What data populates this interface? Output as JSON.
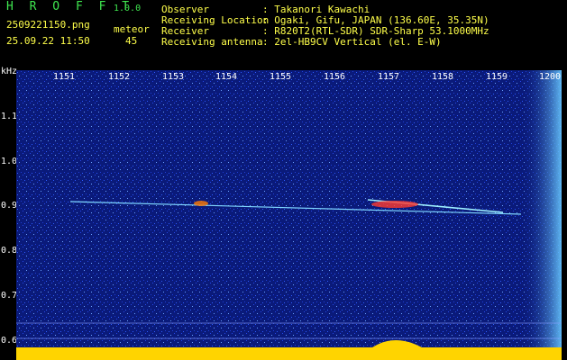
{
  "header": {
    "brand": "H R O F F T",
    "version": "1.0.0",
    "filename": "2509221150.png",
    "datetime": "25.09.22 11:50",
    "meteor_label": "meteor",
    "meteor_count": "45",
    "rows": [
      {
        "label": "Observer",
        "value": ": Takanori Kawachi"
      },
      {
        "label": "Receiving Location",
        "value": ": Ogaki, Gifu, JAPAN (136.60E, 35.35N)"
      },
      {
        "label": "Receiver",
        "value": ": R820T2(RTL-SDR) SDR-Sharp 53.1000MHz"
      },
      {
        "label": "Receiving antenna",
        "value": ": 2el-HB9CV Vertical (el. E-W)"
      }
    ]
  },
  "axes": {
    "unit": "kHz",
    "y_ticks": [
      "1.1",
      "1.0",
      "0.9",
      "0.8",
      "0.7",
      "0.6"
    ],
    "x_ticks": [
      "1151",
      "1152",
      "1153",
      "1154",
      "1155",
      "1156",
      "1157",
      "1158",
      "1159",
      "1200"
    ]
  },
  "colors": {
    "background": "#0a1a7a",
    "signal": "#ffd400",
    "hot": "#ff3b2f"
  }
}
